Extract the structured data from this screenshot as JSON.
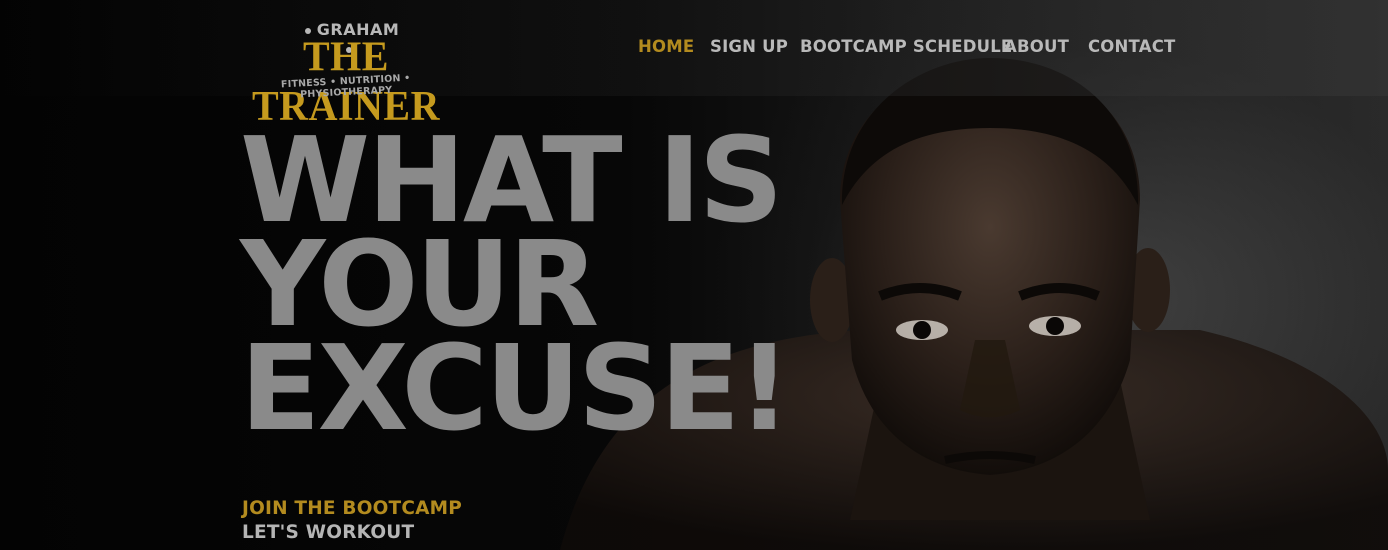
{
  "logo": {
    "top_text": "GRAHAM",
    "main_text": "THE TRAINER",
    "sub_text": "FITNESS • NUTRITION • PHYSIOTHERAPY"
  },
  "nav": {
    "items": [
      {
        "label": "HOME",
        "active": true
      },
      {
        "label": "SIGN UP",
        "active": false
      },
      {
        "label": "BOOTCAMP SCHEDULE",
        "active": false
      },
      {
        "label": "ABOUT",
        "active": false
      },
      {
        "label": "CONTACT",
        "active": false
      }
    ]
  },
  "hero": {
    "headline_lines": [
      "WHAT IS",
      "YOUR",
      "EXCUSE!"
    ],
    "cta_primary": "JOIN THE BOOTCAMP",
    "cta_secondary": "LET'S WORKOUT",
    "image": "muscular-man-portrait"
  },
  "colors": {
    "accent_gold": "#b38b1f",
    "nav_text": "#b9b9b9",
    "headline_grey": "#8a8a8a",
    "background": "#050505"
  }
}
